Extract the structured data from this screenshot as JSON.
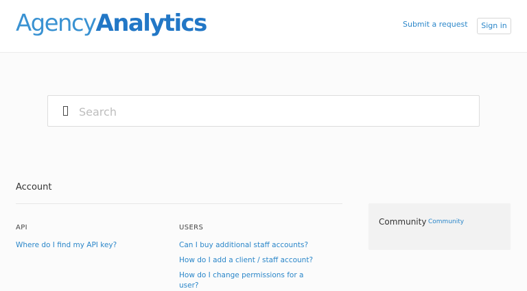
{
  "header": {
    "logo_light": "Agency",
    "logo_bold": "Analytics",
    "submit_request": "Submit a request",
    "sign_in": "Sign in"
  },
  "search": {
    "placeholder": "Search",
    "value": ""
  },
  "section": {
    "title": "Account",
    "columns": [
      {
        "title": "API",
        "articles": [
          "Where do I find my API key?"
        ]
      },
      {
        "title": "USERS",
        "articles": [
          "Can I buy additional staff accounts?",
          "How do I add a client / staff account?",
          "How do I change permissions for a user?"
        ]
      }
    ]
  },
  "community": {
    "title": "Community",
    "link": "Community"
  },
  "colors": {
    "accent": "#2a86c9",
    "logo": "#2277c6"
  },
  "icons": {
    "search": "search-icon"
  }
}
